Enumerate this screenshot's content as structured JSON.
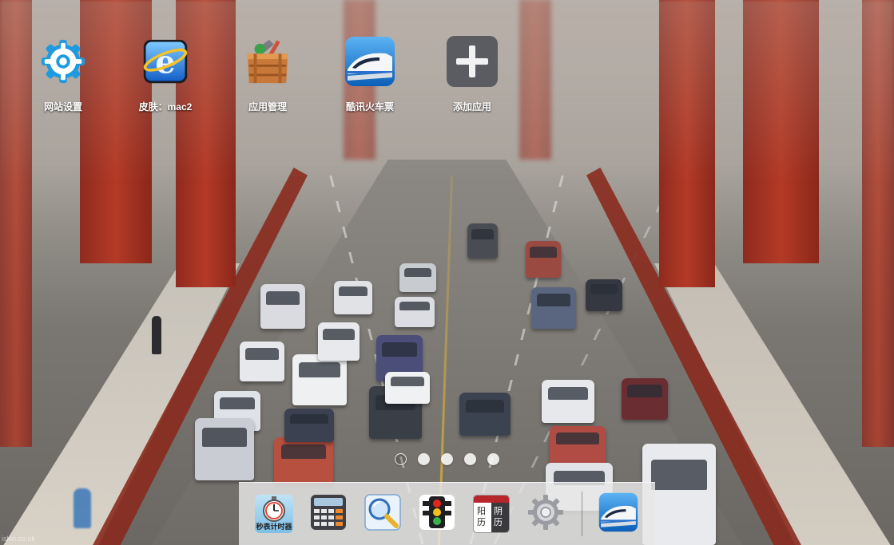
{
  "desktop": {
    "icons": [
      {
        "label": "网站设置",
        "icon": "gear-icon"
      },
      {
        "label": "皮肤：mac2",
        "icon": "ie-browser-icon"
      },
      {
        "label": "应用管理",
        "icon": "toolbox-icon"
      },
      {
        "label": "酷讯火车票",
        "icon": "train-icon"
      },
      {
        "label": "添加应用",
        "icon": "plus-icon"
      }
    ]
  },
  "pager": {
    "pages": 5,
    "active": 1
  },
  "dock": {
    "items": [
      {
        "label": "秒表计时器",
        "icon": "stopwatch-icon"
      },
      {
        "label": "",
        "icon": "calculator-icon"
      },
      {
        "label": "",
        "icon": "magnifier-search-icon"
      },
      {
        "label": "",
        "icon": "traffic-light-icon"
      },
      {
        "label": "阳历",
        "label2": "阴历",
        "icon": "calendar-icon"
      },
      {
        "label": "",
        "icon": "settings-gear-icon"
      },
      {
        "label": "",
        "icon": "train-icon"
      }
    ]
  },
  "watermark": "iskin.co.uk",
  "colors": {
    "bridge_red": "#a8321f",
    "dock_bg": "#e8e8e8",
    "accent_blue": "#1e88d9"
  }
}
